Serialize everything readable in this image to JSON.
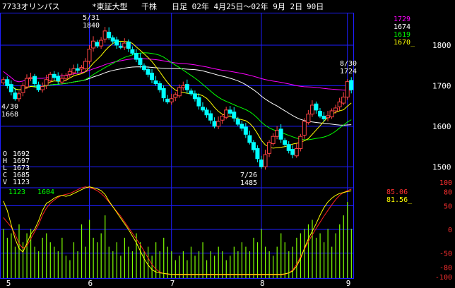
{
  "header": {
    "ticker": "7733オリンパス",
    "market": "*東証大型",
    "unit": "千株",
    "period": "日足 02年 4月25日～02年 9月 2日",
    "days": "90日"
  },
  "ohlc_box": {
    "labels": [
      "O",
      "H",
      "L",
      "C",
      "V"
    ],
    "values": [
      "1692",
      "1697",
      "1673",
      "1685",
      "1123"
    ]
  },
  "legend_ma": [
    "1729",
    "1674",
    "1619",
    "1670_"
  ],
  "legend_ma_colors": [
    "#ff00ff",
    "#ffffff",
    "#00ff00",
    "#ffff00"
  ],
  "annotations": [
    {
      "date": "5/31",
      "value": "1840"
    },
    {
      "date": "4/30",
      "value": "1668"
    },
    {
      "date": "7/26",
      "value": "1485"
    },
    {
      "date": "8/30",
      "value": "1724"
    }
  ],
  "volume_legend": {
    "a": "1123",
    "b": "1604"
  },
  "osc_legend": {
    "red": "85.06",
    "yellow": "81.56_"
  },
  "colors": {
    "background": "#000000",
    "grid": "#1e1eff",
    "candle_up": "#ff4444",
    "candle_down": "#00ffff",
    "ma_magenta": "#ff00ff",
    "ma_white": "#ffffff",
    "ma_green": "#00ff00",
    "ma_yellow": "#ffff00",
    "osc_red": "#ff2020",
    "osc_yellow": "#ffff00",
    "volume": "#7fff00",
    "axis_text": "#ffffff",
    "osc_axis_text": "#ff3030"
  },
  "chart_data": {
    "type": "candlestick",
    "price_axis": {
      "ticks": [
        1800,
        1700,
        1600,
        1500
      ],
      "range": [
        1450,
        1880
      ]
    },
    "osc_axis": {
      "ticks": [
        "100",
        "80",
        "50",
        "0",
        "-50",
        "-80",
        "-100"
      ]
    },
    "x_labels": [
      "5",
      "6",
      "7",
      "8",
      "9"
    ],
    "moving_averages": [
      {
        "color": "magenta",
        "value": 1729
      },
      {
        "color": "white",
        "value": 1674
      },
      {
        "color": "green",
        "value": 1619
      },
      {
        "color": "yellow",
        "value": 1670
      }
    ],
    "last_bar": {
      "O": 1692,
      "H": 1697,
      "L": 1673,
      "C": 1685,
      "V": 1123
    },
    "extremes": [
      {
        "date": "5/31",
        "price": 1840,
        "type": "high"
      },
      {
        "date": "4/30",
        "price": 1668,
        "type": "low"
      },
      {
        "date": "7/26",
        "price": 1485,
        "type": "low"
      },
      {
        "date": "8/30",
        "price": 1724,
        "type": "high"
      }
    ],
    "closes": [
      1715,
      1700,
      1685,
      1668,
      1680,
      1700,
      1718,
      1720,
      1705,
      1690,
      1698,
      1715,
      1728,
      1720,
      1712,
      1718,
      1725,
      1735,
      1742,
      1738,
      1745,
      1760,
      1790,
      1810,
      1798,
      1812,
      1835,
      1818,
      1810,
      1800,
      1795,
      1805,
      1792,
      1780,
      1765,
      1752,
      1740,
      1728,
      1715,
      1705,
      1690,
      1670,
      1660,
      1668,
      1678,
      1695,
      1700,
      1690,
      1680,
      1668,
      1650,
      1640,
      1628,
      1615,
      1600,
      1612,
      1625,
      1640,
      1632,
      1620,
      1605,
      1595,
      1580,
      1560,
      1542,
      1520,
      1500,
      1530,
      1560,
      1575,
      1590,
      1568,
      1555,
      1540,
      1530,
      1545,
      1575,
      1612,
      1630,
      1652,
      1640,
      1625,
      1618,
      1626,
      1638,
      1645,
      1660,
      1672,
      1710,
      1690
    ],
    "volumes": [
      0.55,
      0.45,
      0.5,
      0.35,
      0.6,
      0.4,
      0.5,
      0.55,
      0.35,
      0.3,
      0.45,
      0.5,
      0.4,
      0.35,
      0.3,
      0.45,
      0.25,
      0.2,
      0.4,
      0.3,
      0.6,
      0.35,
      0.65,
      0.45,
      0.4,
      0.5,
      0.7,
      0.35,
      0.3,
      0.4,
      0.25,
      0.45,
      0.35,
      0.3,
      0.5,
      0.4,
      0.3,
      0.35,
      0.25,
      0.4,
      0.3,
      0.45,
      0.35,
      0.3,
      0.2,
      0.25,
      0.3,
      0.2,
      0.35,
      0.25,
      0.3,
      0.4,
      0.2,
      0.3,
      0.25,
      0.35,
      0.3,
      0.2,
      0.25,
      0.35,
      0.3,
      0.4,
      0.35,
      0.3,
      0.45,
      0.4,
      0.55,
      0.35,
      0.3,
      0.25,
      0.35,
      0.5,
      0.4,
      0.3,
      0.35,
      0.45,
      0.5,
      0.55,
      0.6,
      0.65,
      0.45,
      0.5,
      0.4,
      0.55,
      0.35,
      0.5,
      0.6,
      0.7,
      0.85,
      0.55
    ],
    "osc_red": [
      25,
      15,
      5,
      -10,
      -30,
      -40,
      -35,
      -20,
      -5,
      10,
      30,
      45,
      55,
      62,
      68,
      72,
      74,
      76,
      80,
      84,
      88,
      90,
      88,
      86,
      82,
      76,
      68,
      58,
      48,
      38,
      28,
      16,
      4,
      -8,
      -20,
      -32,
      -46,
      -60,
      -74,
      -84,
      -90,
      -93,
      -95,
      -95,
      -96,
      -96,
      -96,
      -96,
      -96,
      -96,
      -96,
      -96,
      -96,
      -96,
      -96,
      -96,
      -96,
      -96,
      -96,
      -96,
      -96,
      -96,
      -96,
      -96,
      -96,
      -96,
      -96,
      -96,
      -96,
      -96,
      -96,
      -96,
      -95,
      -92,
      -86,
      -74,
      -58,
      -42,
      -26,
      -12,
      2,
      15,
      28,
      40,
      52,
      63,
      72,
      78,
      82,
      85.06
    ],
    "osc_yellow": [
      60,
      40,
      10,
      -20,
      -40,
      -48,
      -30,
      -10,
      0,
      18,
      40,
      55,
      60,
      66,
      70,
      72,
      70,
      72,
      76,
      80,
      84,
      88,
      90,
      88,
      86,
      82,
      74,
      60,
      48,
      36,
      24,
      12,
      0,
      -14,
      -28,
      -45,
      -62,
      -75,
      -85,
      -90,
      -92,
      -93,
      -94,
      -95,
      -95,
      -95,
      -95,
      -95,
      -95,
      -95,
      -95,
      -95,
      -95,
      -95,
      -95,
      -95,
      -95,
      -95,
      -95,
      -95,
      -95,
      -95,
      -95,
      -95,
      -95,
      -95,
      -95,
      -95,
      -95,
      -95,
      -95,
      -95,
      -94,
      -92,
      -88,
      -78,
      -62,
      -40,
      -20,
      -4,
      12,
      30,
      46,
      58,
      66,
      72,
      76,
      78,
      80,
      81.56
    ]
  }
}
